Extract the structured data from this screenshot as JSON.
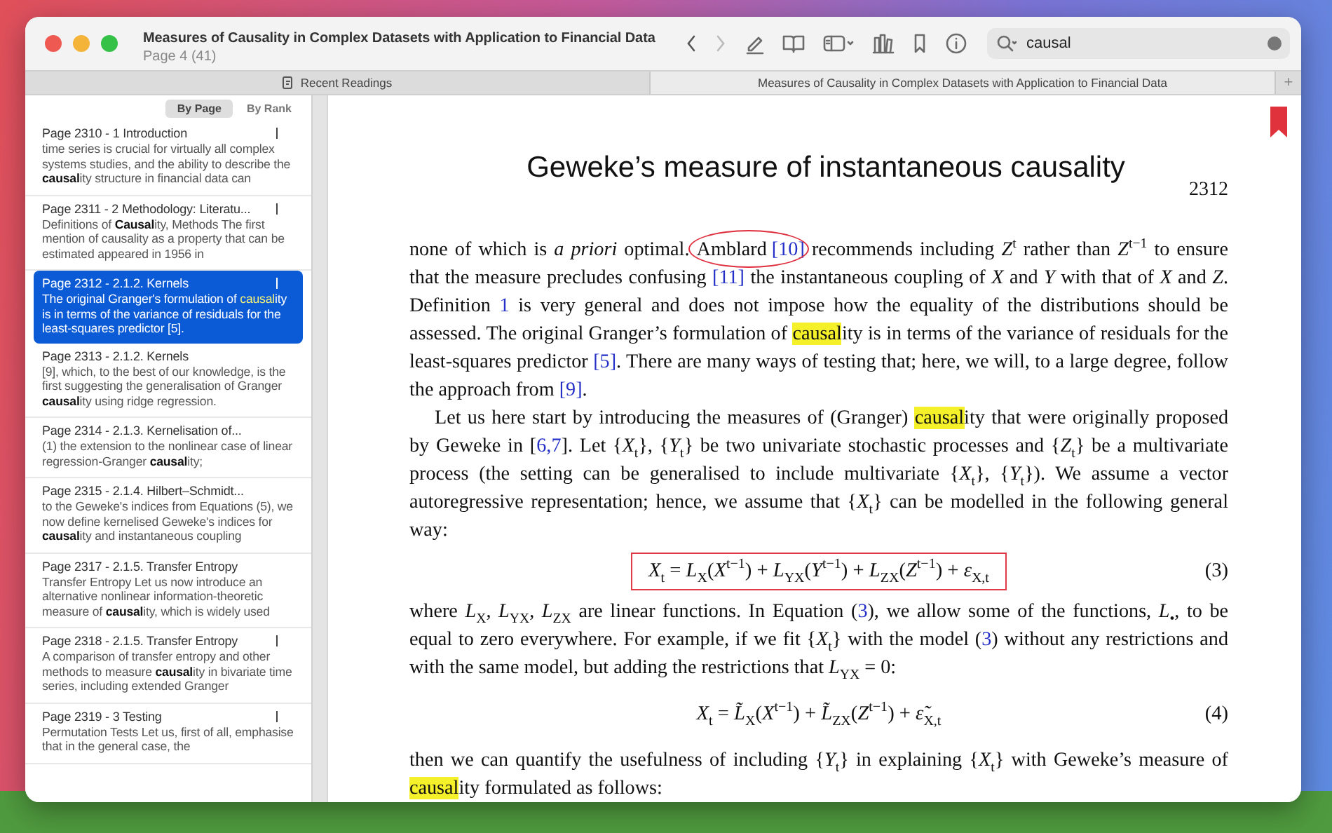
{
  "window": {
    "title": "Measures of Causality in Complex Datasets with Application to Financial Data",
    "subtitle": "Page 4 (41)"
  },
  "toolbar": {
    "back_disabled": false,
    "forward_disabled": true,
    "search": {
      "value": "causal"
    },
    "new_tab": "+"
  },
  "tabs": [
    {
      "label": "Recent Readings",
      "kind": "recent",
      "selected": false
    },
    {
      "label": "Measures of Causality in Complex Datasets with Application to Financial Data",
      "kind": "document",
      "selected": true
    }
  ],
  "sidebar": {
    "sort_options": [
      {
        "label": "By Page",
        "selected": true
      },
      {
        "label": "By Rank",
        "selected": false
      }
    ],
    "results": [
      {
        "title": "Page 2310 - 1 Introduction",
        "snippet": "time series is crucial for virtually all complex systems studies, and the ability to describe the **causal**ity structure in financial data can",
        "marked": true,
        "selected": false
      },
      {
        "title": "Page 2311 - 2 Methodology: Literatu...",
        "snippet": "Definitions of **Causal**ity, Methods The first mention of causality as a property that can be estimated appeared in 1956 in",
        "marked": true,
        "selected": false
      },
      {
        "title": "Page 2312 - 2.1.2.  Kernels",
        "snippet": "The original Granger's formulation of **causal**ity is in terms of the variance of residuals for the least-squares predictor [5].",
        "marked": true,
        "selected": true
      },
      {
        "title": "Page 2313 - 2.1.2.  Kernels",
        "snippet": "[9], which, to the best of our knowledge, is the first suggesting the generalisation of Granger **causal**ity using ridge regression.",
        "marked": false,
        "selected": false
      },
      {
        "title": "Page 2314 - 2.1.3.  Kernelisation of...",
        "snippet": "(1) the extension to the nonlinear case of linear regression-Granger **causal**ity;",
        "marked": false,
        "selected": false
      },
      {
        "title": "Page 2315 - 2.1.4.  Hilbert–Schmidt...",
        "snippet": "to the Geweke's indices from Equations (5), we now define kernelised Geweke's indices for **causal**ity and instantaneous coupling",
        "marked": false,
        "selected": false
      },
      {
        "title": "Page 2317 - 2.1.5.  Transfer Entropy",
        "snippet": "Transfer Entropy Let us now introduce an alternative nonlinear information-theoretic measure of **causal**ity, which is widely used",
        "marked": false,
        "selected": false
      },
      {
        "title": "Page 2318 - 2.1.5.  Transfer Entropy",
        "snippet": "A comparison of transfer entropy and other methods to measure **causal**ity in bivariate time series, including extended Granger",
        "marked": true,
        "selected": false
      },
      {
        "title": "Page 2319 - 3 Testing",
        "snippet": "Permutation Tests Let us, first of all, emphasise that in the general case, the",
        "marked": true,
        "selected": false
      }
    ]
  },
  "page": {
    "heading": "Geweke’s measure of instantaneous causality",
    "page_number": "2312",
    "bookmarked": true,
    "blocks": [
      {
        "kind": "paragraph",
        "indent": false,
        "segments": [
          {
            "kind": "text",
            "text": "none of which is *a priori* optimal. "
          },
          {
            "kind": "circled",
            "parts": [
              {
                "kind": "text",
                "text": "Amblard "
              },
              {
                "kind": "link",
                "text": "[10]"
              }
            ]
          },
          {
            "kind": "text",
            "text": " recommends including *Z*$^{t}$ rather than *Z*$^{t−1}$ to ensure that the measure precludes confusing "
          },
          {
            "kind": "link",
            "text": "[11]"
          },
          {
            "kind": "text",
            "text": " the instantaneous coupling of *X* and *Y* with that of *X* and *Z*. Definition "
          },
          {
            "kind": "link",
            "text": "1"
          },
          {
            "kind": "text",
            "text": " is very general and does not impose how the equality of the distributions should be assessed. The original Granger’s formulation of "
          },
          {
            "kind": "highlight",
            "text": "causal"
          },
          {
            "kind": "text",
            "text": "ity is in terms of the variance of residuals for the least-squares predictor "
          },
          {
            "kind": "link",
            "text": "[5]"
          },
          {
            "kind": "text",
            "text": ". There are many ways of testing that; here, we will, to a large degree, follow the approach from "
          },
          {
            "kind": "link",
            "text": "[9]"
          },
          {
            "kind": "text",
            "text": "."
          }
        ]
      },
      {
        "kind": "paragraph",
        "indent": true,
        "segments": [
          {
            "kind": "text",
            "text": "Let us here start by introducing the measures of (Granger) "
          },
          {
            "kind": "highlight",
            "text": "causal"
          },
          {
            "kind": "text",
            "text": "ity that were originally proposed by Geweke in ["
          },
          {
            "kind": "link",
            "text": "6,7"
          },
          {
            "kind": "text",
            "text": "].  Let {*X*$_{t}$}, {*Y*$_{t}$} be two univariate stochastic processes and {*Z*$_{t}$} be a multivariate process (the setting can be generalised to include multivariate {*X*$_{t}$}, {*Y*$_{t}$}).  We assume a vector autoregressive representation; hence, we assume that {*X*$_{t}$} can be modelled in the following general way:"
          }
        ]
      },
      {
        "kind": "equation",
        "formula": "*X*$_{t}$ = *L*$_{X}$(*X*$^{t−1}$) + *L*$_{YX}$(*Y*$^{t−1}$) + *L*$_{ZX}$(*Z*$^{t−1}$) + *ε*$_{X,t}$",
        "number": "(3)",
        "boxed": true
      },
      {
        "kind": "paragraph",
        "indent": false,
        "segments": [
          {
            "kind": "text",
            "text": "where *L*$_{X}$, *L*$_{YX}$, *L*$_{ZX}$ are linear functions. In Equation ("
          },
          {
            "kind": "link",
            "text": "3"
          },
          {
            "kind": "text",
            "text": "), we allow some of the functions, *L*$_{•}$, to be equal to zero everywhere. For example, if we fit {*X*$_{t}$} with the model ("
          },
          {
            "kind": "link",
            "text": "3"
          },
          {
            "kind": "text",
            "text": ") without any restrictions and with the same model, but adding the restrictions that *L*$_{YX}$ = 0:"
          }
        ]
      },
      {
        "kind": "equation",
        "formula": "*X*$_{t}$ = *L̃*$_{X}$(*X*$^{t−1}$) + *L̃*$_{ZX}$(*Z*$^{t−1}$) + *ε̃*$_{X,t}$",
        "number": "(4)",
        "boxed": false
      },
      {
        "kind": "paragraph",
        "indent": false,
        "segments": [
          {
            "kind": "text",
            "text": "then we can quantify the usefulness of including {*Y*$_{t}$} in explaining {*X*$_{t}$} with Geweke’s measure of "
          },
          {
            "kind": "highlight",
            "text": "causal"
          },
          {
            "kind": "text",
            "text": "ity formulated as follows:"
          }
        ]
      }
    ]
  }
}
